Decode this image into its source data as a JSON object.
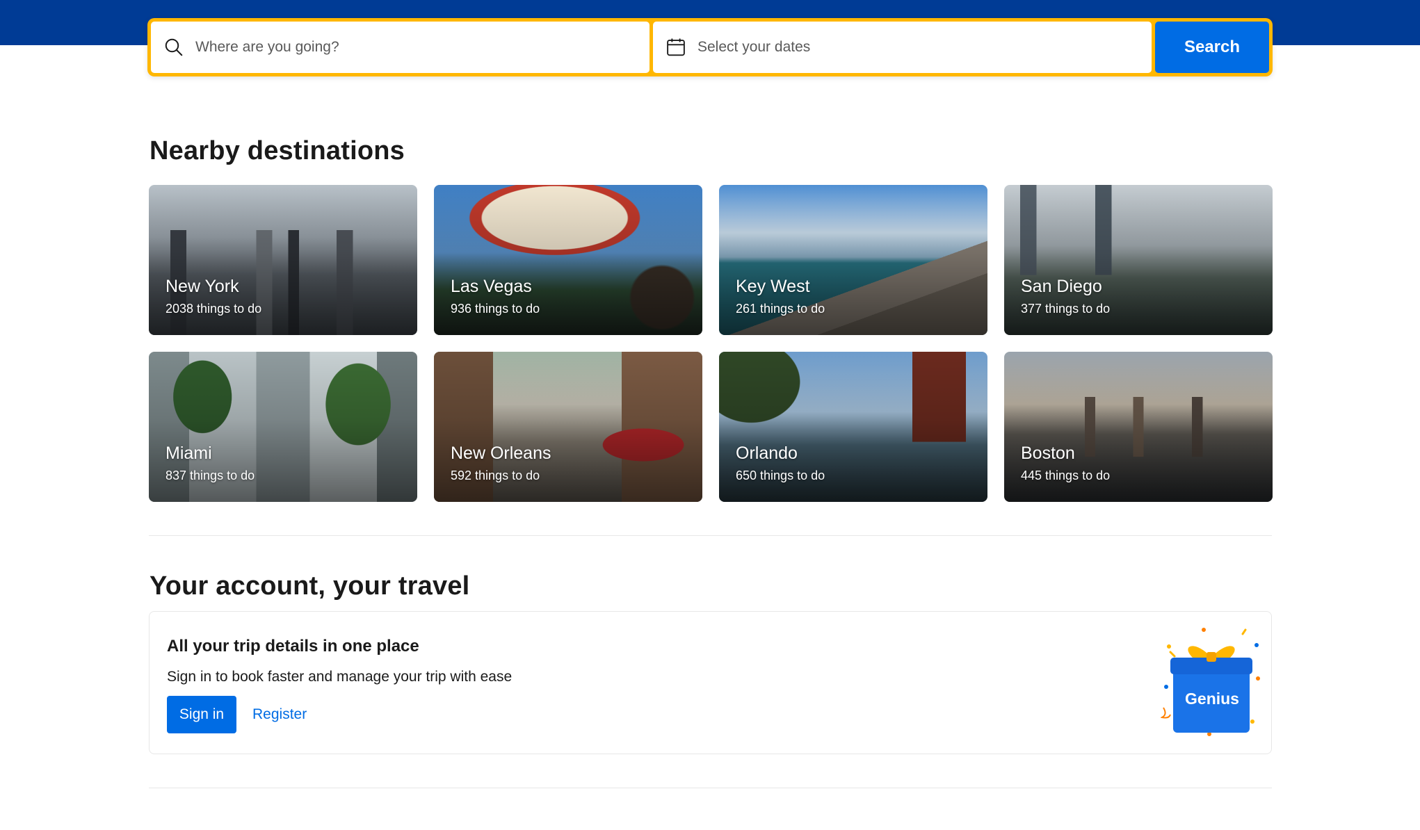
{
  "search": {
    "destination_placeholder": "Where are you going?",
    "dates_placeholder": "Select your dates",
    "search_button_label": "Search"
  },
  "nearby": {
    "title": "Nearby destinations",
    "destinations": [
      {
        "name": "New York",
        "count": "2038 things to do"
      },
      {
        "name": "Las Vegas",
        "count": "936 things to do"
      },
      {
        "name": "Key West",
        "count": "261 things to do"
      },
      {
        "name": "San Diego",
        "count": "377 things to do"
      },
      {
        "name": "Miami",
        "count": "837 things to do"
      },
      {
        "name": "New Orleans",
        "count": "592 things to do"
      },
      {
        "name": "Orlando",
        "count": "650 things to do"
      },
      {
        "name": "Boston",
        "count": "445 things to do"
      }
    ]
  },
  "account": {
    "title": "Your account, your travel",
    "card_heading": "All your trip details in one place",
    "card_subtext": "Sign in to book faster and manage your trip with ease",
    "sign_in_label": "Sign in",
    "register_label": "Register",
    "genius_label": "Genius"
  },
  "colors": {
    "header_blue": "#003b95",
    "search_border_yellow": "#ffb700",
    "action_blue": "#006ce4"
  },
  "icons": {
    "destination": "search-icon",
    "dates": "calendar-icon",
    "genius": "gift-icon"
  }
}
